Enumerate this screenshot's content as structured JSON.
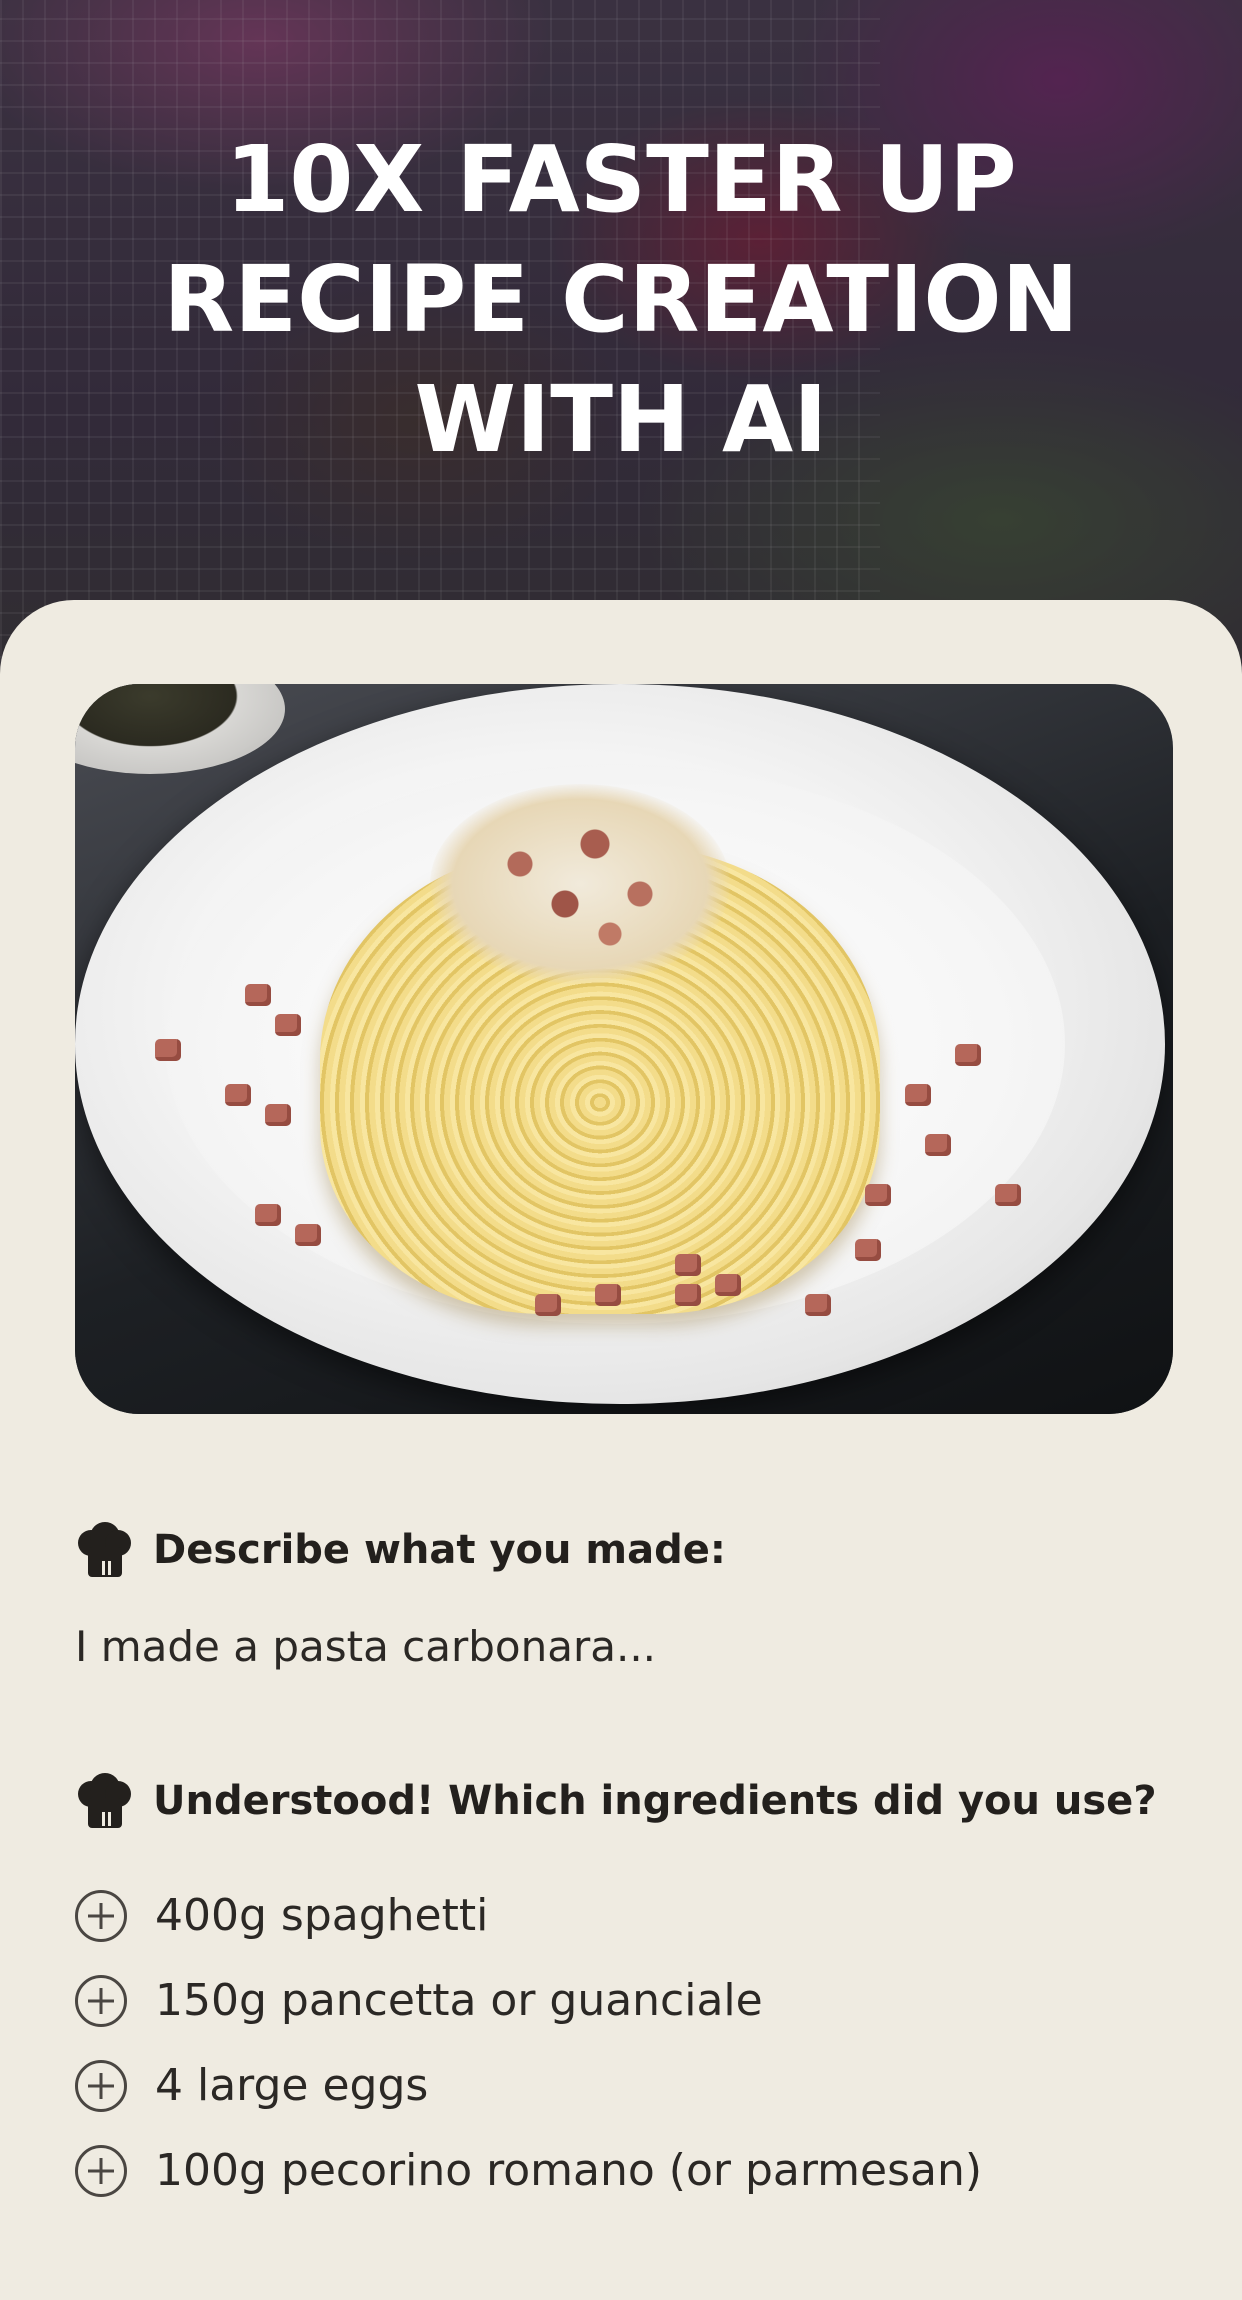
{
  "hero": {
    "headline_lines": [
      "10X FASTER  UP",
      "RECIPE CREATION",
      "WITH  AI"
    ]
  },
  "photo": {
    "description_icon": "pasta-dish-photo"
  },
  "conversation": {
    "question1": "Describe what you made:",
    "answer1": "I made a pasta carbonara...",
    "question2": "Understood! Which ingredients did you use?",
    "ingredients": [
      "400g spaghetti",
      "150g pancetta or guanciale",
      "4 large eggs",
      "100g pecorino romano (or parmesan)"
    ]
  },
  "icons": {
    "chef": "chef-hat-icon",
    "add": "plus-circle-icon"
  },
  "colors": {
    "card_background": "#efebe1",
    "text_dark": "#23201d",
    "headline": "#ffffff"
  }
}
